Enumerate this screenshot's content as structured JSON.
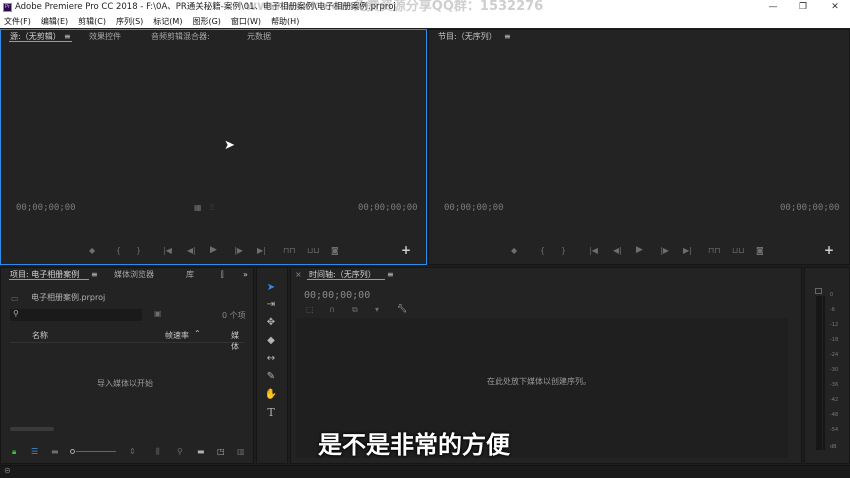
{
  "window": {
    "title": "Adobe Premiere Pro CC 2018 - F:\\0A、PR通关秘籍-案例\\01、电子相册案例\\电子相册案例.prproj",
    "watermark": "www.xxxx.com免费资源分享QQ群：1532276",
    "logo": "Pr"
  },
  "menu": [
    "文件(F)",
    "编辑(E)",
    "剪辑(C)",
    "序列(S)",
    "标记(M)",
    "图形(G)",
    "窗口(W)",
    "帮助(H)"
  ],
  "source_panel": {
    "tabs": [
      "源:（无剪辑）",
      "效果控件",
      "音频剪辑混合器:",
      "元数据"
    ],
    "tc_left": "00;00;00;00",
    "tc_right": "00;00;00;00"
  },
  "program_panel": {
    "title": "节目:（无序列）",
    "tc_left": "00;00;00;00",
    "tc_right": "00;00;00;00"
  },
  "project_panel": {
    "tabs": [
      "项目: 电子相册案例",
      "媒体浏览器",
      "库"
    ],
    "file": "电子相册案例.prproj",
    "item_count": "0 个项",
    "col_name": "名称",
    "col_rate": "帧速率",
    "col_media": "媒体",
    "empty": "导入媒体以开始"
  },
  "timeline": {
    "title": "时间轴:（无序列）",
    "tc": "00;00;00;00",
    "empty": "在此处放下媒体以创建序列。"
  },
  "meter": {
    "labels": [
      "0",
      "-6",
      "-12",
      "-18",
      "-24",
      "-30",
      "-36",
      "-42",
      "-48",
      "-54",
      "dB"
    ]
  },
  "subtitle": "是不是非常的方便",
  "accent": "#2d8ceb"
}
